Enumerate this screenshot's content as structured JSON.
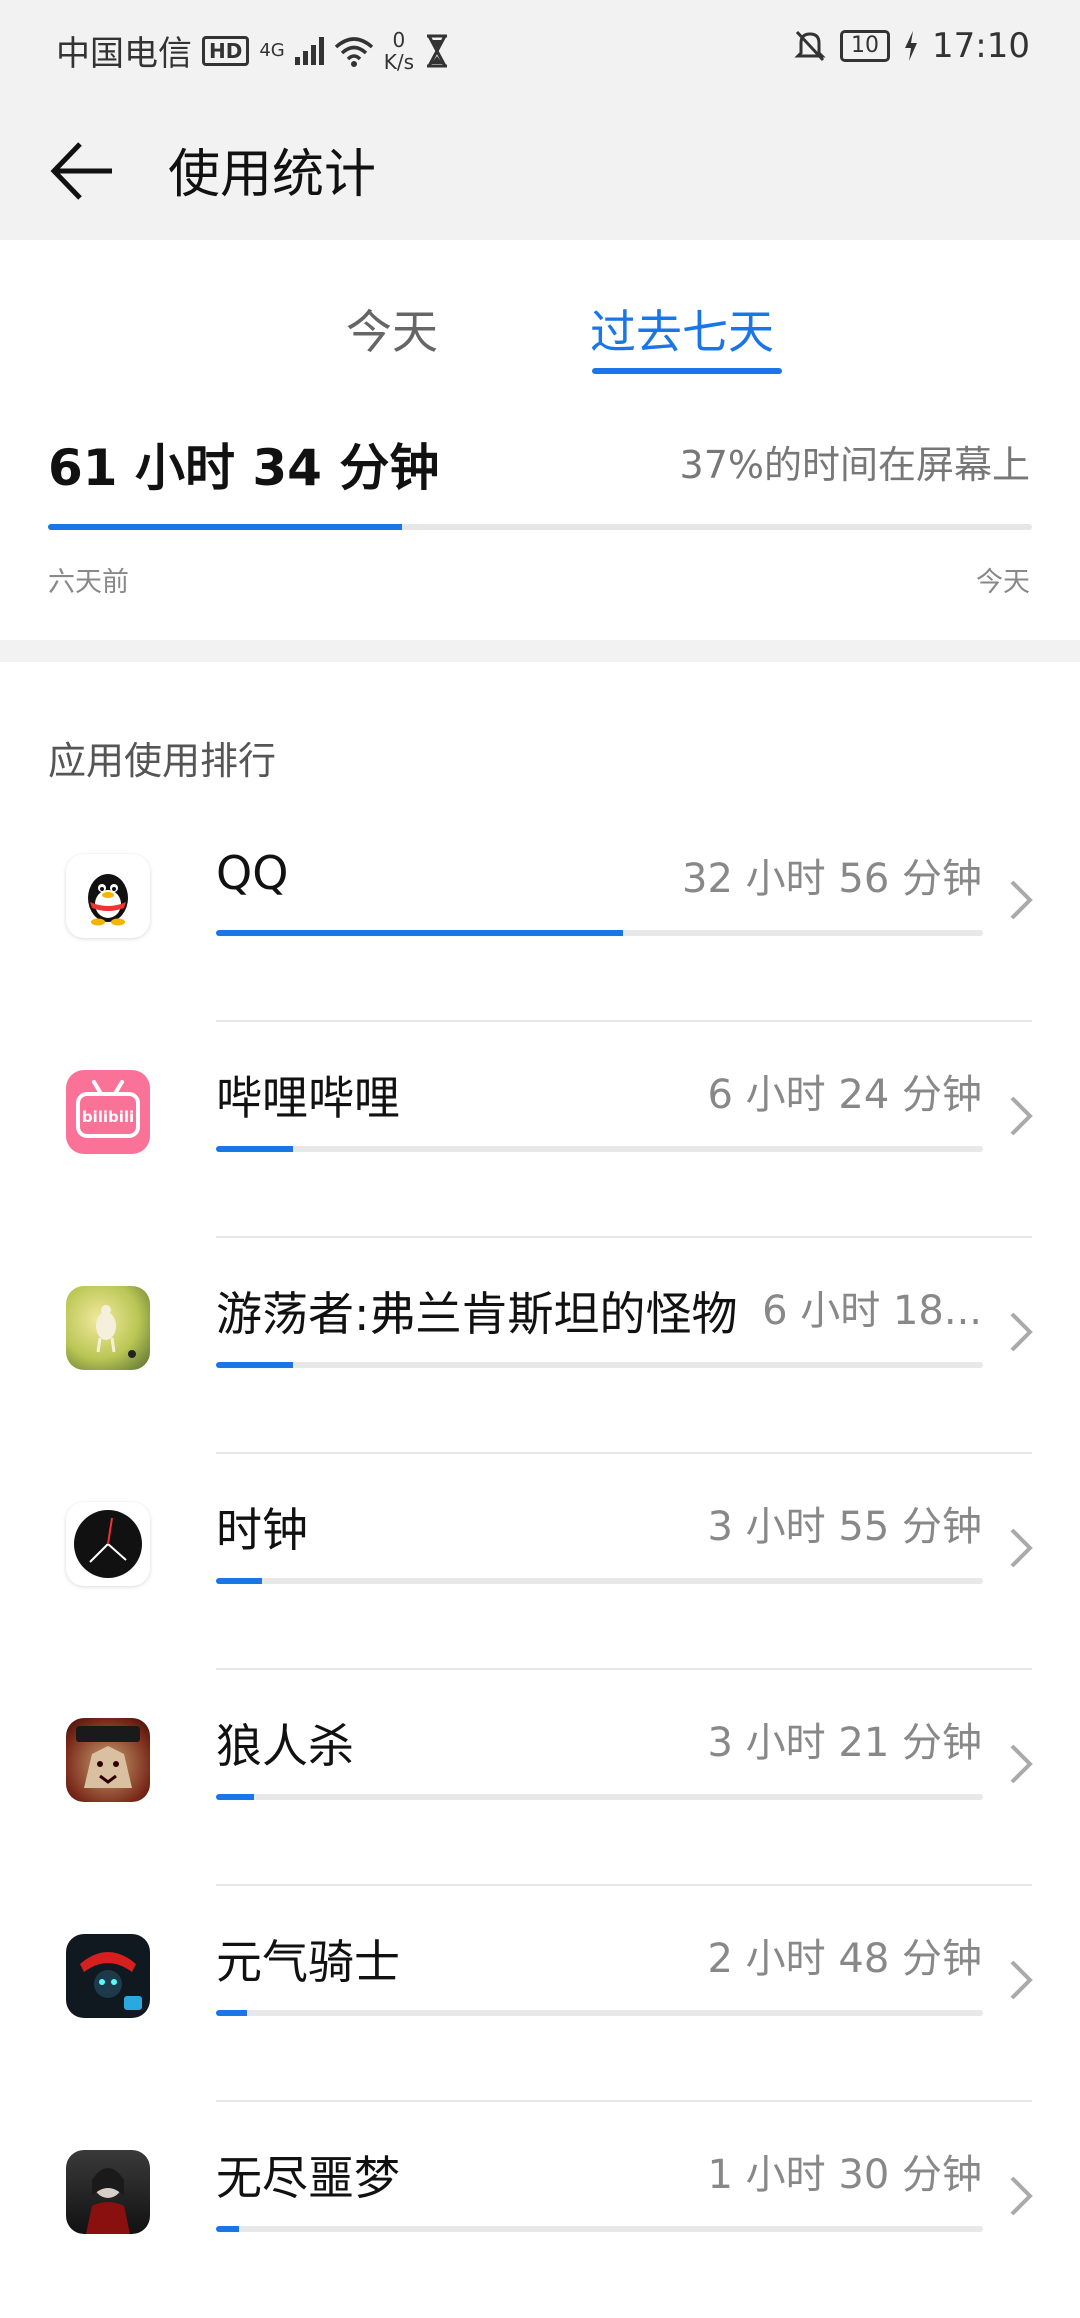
{
  "status_bar": {
    "carrier": "中国电信",
    "hd": "HD",
    "network": "4G",
    "speed_value": "0",
    "speed_unit": "K/s",
    "battery": "10",
    "time": "17:10"
  },
  "header": {
    "title": "使用统计"
  },
  "tabs": [
    {
      "label": "今天",
      "selected": false
    },
    {
      "label": "过去七天",
      "selected": true
    }
  ],
  "summary": {
    "total": "61 小时 34 分钟",
    "screen_ratio": "37%的时间在屏幕上",
    "progress": 0.36,
    "start_label": "六天前",
    "end_label": "今天"
  },
  "ranking": {
    "title": "应用使用排行",
    "apps": [
      {
        "name": "QQ",
        "time": "32 小时 56 分钟",
        "progress": 0.53,
        "icon": "qq-icon"
      },
      {
        "name": "哔哩哔哩",
        "time": "6 小时 24 分钟",
        "progress": 0.1,
        "icon": "bilibili-icon"
      },
      {
        "name": "游荡者:弗兰肯斯坦的怪物",
        "time": "6 小时 18...",
        "progress": 0.1,
        "icon": "wanderer-game-icon"
      },
      {
        "name": "时钟",
        "time": "3 小时 55 分钟",
        "progress": 0.06,
        "icon": "clock-icon"
      },
      {
        "name": "狼人杀",
        "time": "3 小时 21 分钟",
        "progress": 0.05,
        "icon": "werewolf-icon"
      },
      {
        "name": "元气骑士",
        "time": "2 小时 48 分钟",
        "progress": 0.04,
        "icon": "soul-knight-icon"
      },
      {
        "name": "无尽噩梦",
        "time": "1 小时 30 分钟",
        "progress": 0.03,
        "icon": "endless-nightmare-icon"
      }
    ]
  },
  "colors": {
    "accent": "#1976e8",
    "bilibili_pink": "#fb7299"
  }
}
